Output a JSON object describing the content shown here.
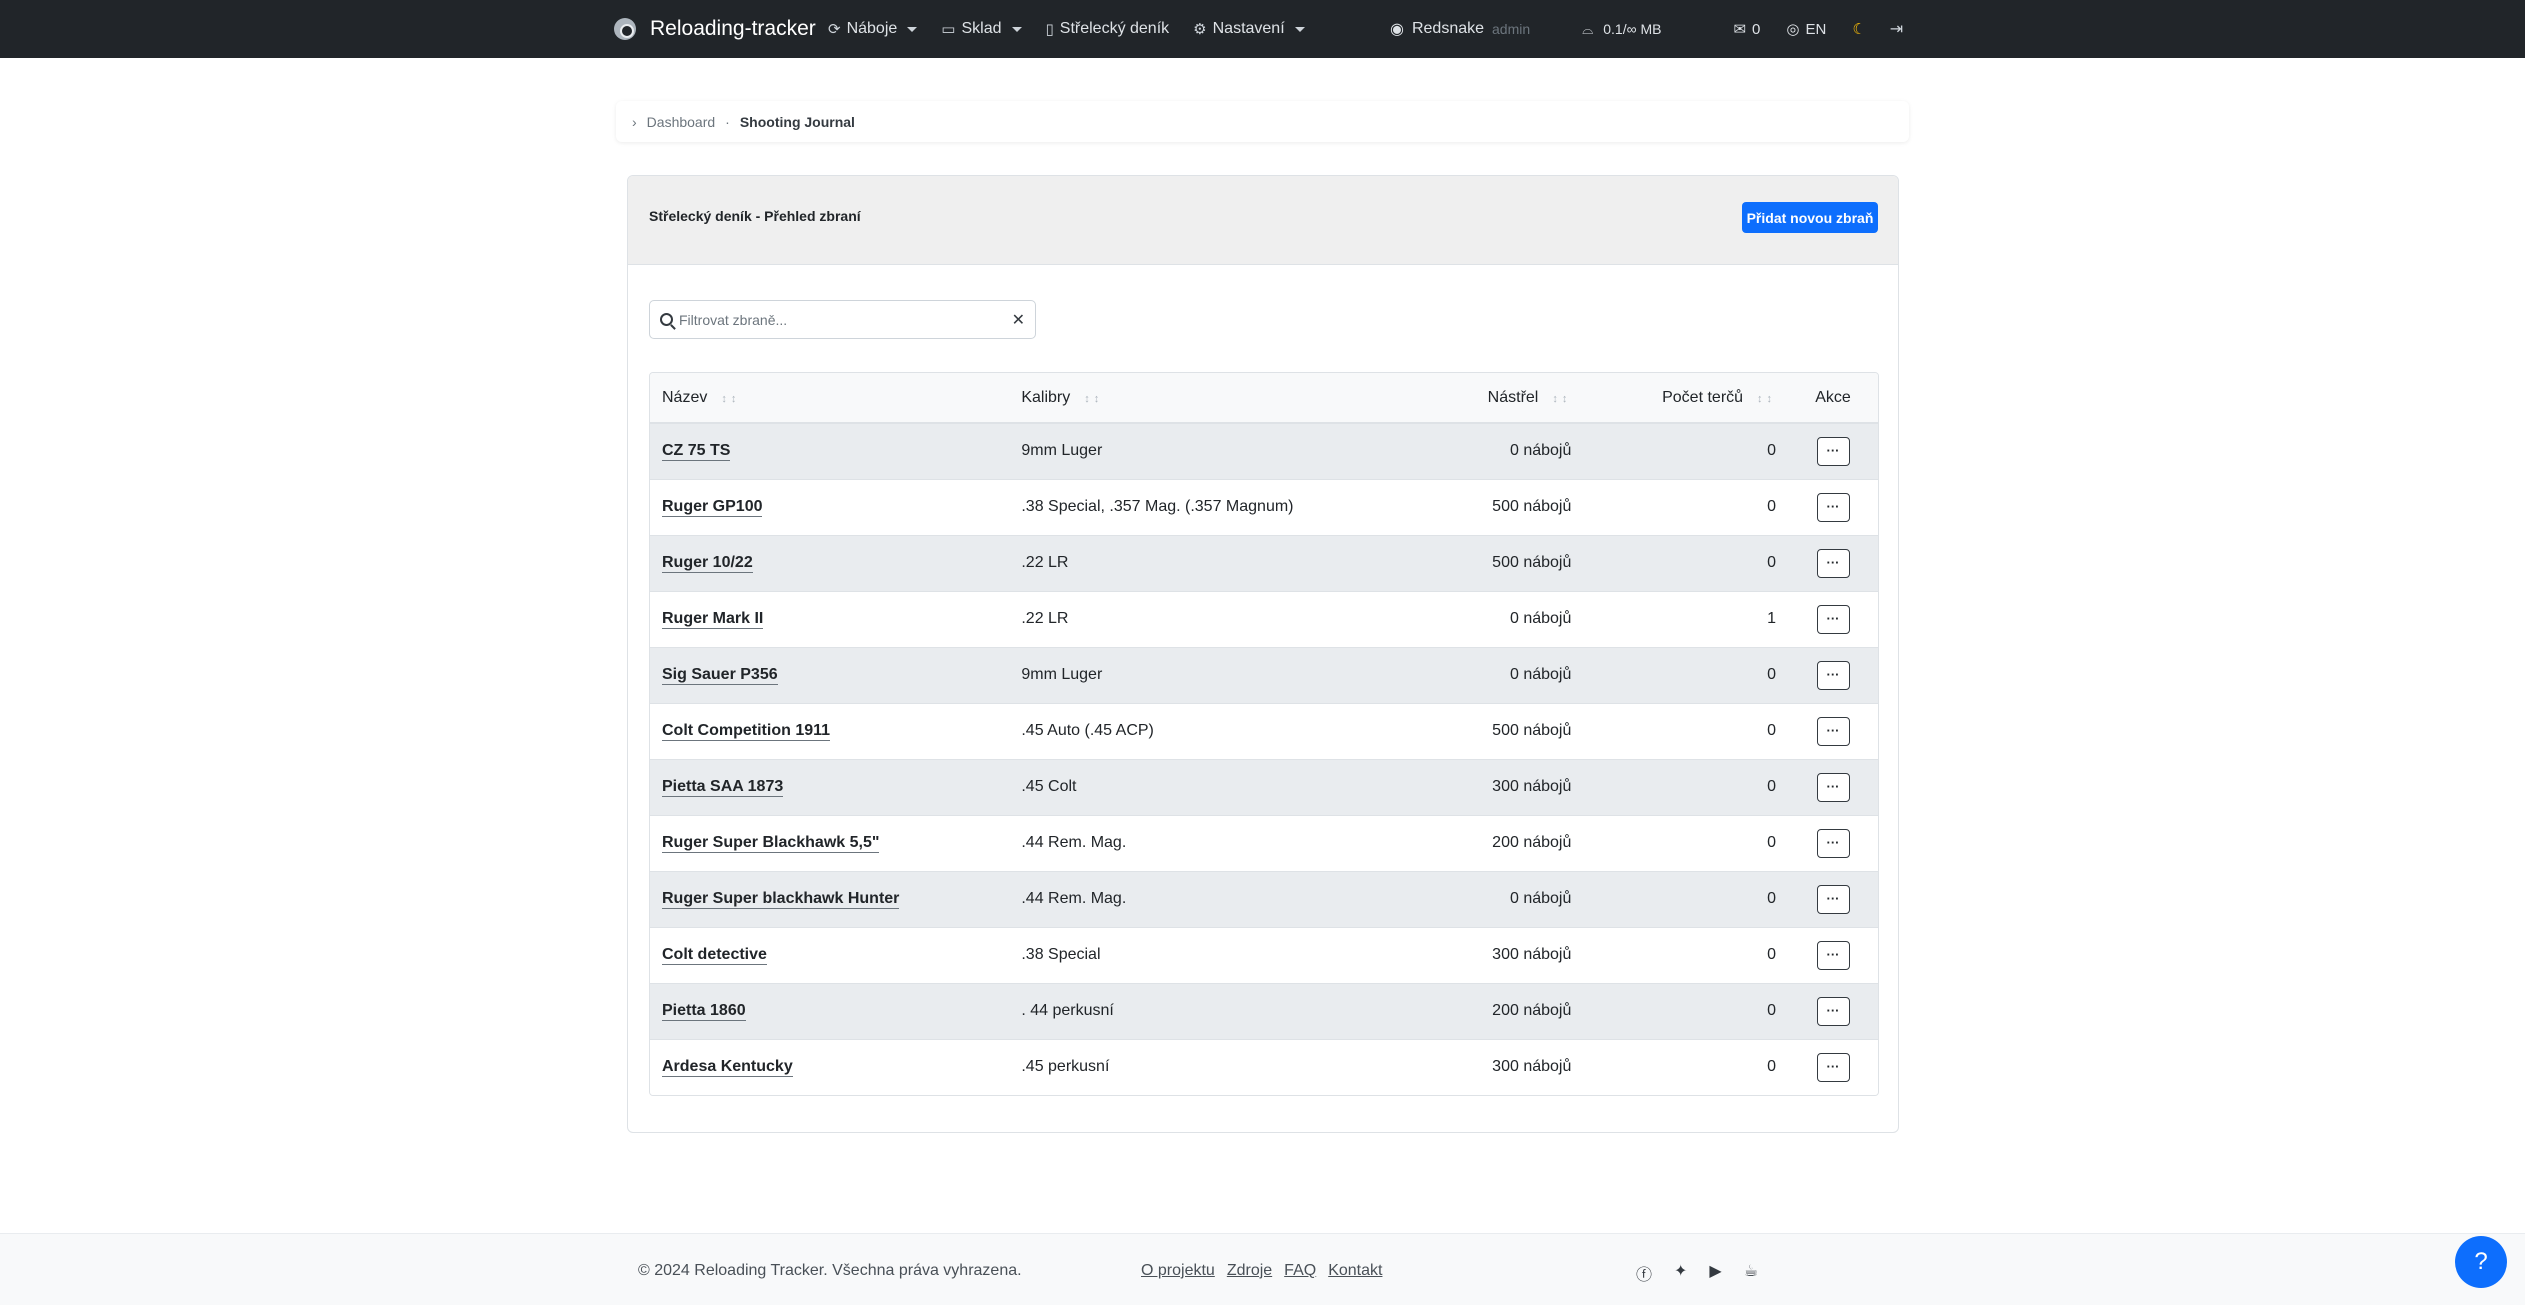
{
  "navbar": {
    "brand": "Reloading-tracker",
    "items": [
      {
        "label": "Náboje",
        "icon": "refresh-icon",
        "dropdown": true
      },
      {
        "label": "Sklad",
        "icon": "box-icon",
        "dropdown": true
      },
      {
        "label": "Střelecký deník",
        "icon": "journal-icon",
        "dropdown": false
      },
      {
        "label": "Nastavení",
        "icon": "gear-icon",
        "dropdown": true
      }
    ],
    "user": "Redsnake",
    "role": "admin",
    "storage": "0.1/∞ MB",
    "messages": "0",
    "lang": "EN"
  },
  "breadcrumb": {
    "home": "Dashboard",
    "current": "Shooting Journal"
  },
  "card": {
    "title": "Střelecký deník - Přehled zbraní",
    "add_button": "Přidat novou zbraň",
    "filter_placeholder": "Filtrovat zbraně..."
  },
  "table": {
    "headers": {
      "name": "Název",
      "calibers": "Kalibry",
      "shots": "Nástřel",
      "targets": "Počet terčů",
      "actions": "Akce"
    },
    "action_label": "···",
    "rows": [
      {
        "name": "CZ 75 TS",
        "calibers": "9mm Luger",
        "shots": "0 nábojů",
        "targets": "0"
      },
      {
        "name": "Ruger GP100",
        "calibers": ".38 Special, .357 Mag. (.357 Magnum)",
        "shots": "500 nábojů",
        "targets": "0"
      },
      {
        "name": "Ruger 10/22",
        "calibers": ".22 LR",
        "shots": "500 nábojů",
        "targets": "0"
      },
      {
        "name": "Ruger Mark II",
        "calibers": ".22 LR",
        "shots": "0 nábojů",
        "targets": "1"
      },
      {
        "name": "Sig Sauer P356",
        "calibers": "9mm Luger",
        "shots": "0 nábojů",
        "targets": "0"
      },
      {
        "name": "Colt Competition 1911",
        "calibers": ".45 Auto (.45 ACP)",
        "shots": "500 nábojů",
        "targets": "0"
      },
      {
        "name": "Pietta SAA 1873",
        "calibers": ".45 Colt",
        "shots": "300 nábojů",
        "targets": "0"
      },
      {
        "name": "Ruger Super Blackhawk 5,5\"",
        "calibers": ".44 Rem. Mag.",
        "shots": "200 nábojů",
        "targets": "0"
      },
      {
        "name": "Ruger Super blackhawk Hunter",
        "calibers": ".44 Rem. Mag.",
        "shots": "0 nábojů",
        "targets": "0"
      },
      {
        "name": "Colt detective",
        "calibers": ".38 Special",
        "shots": "300 nábojů",
        "targets": "0"
      },
      {
        "name": "Pietta 1860",
        "calibers": ". 44 perkusní",
        "shots": "200 nábojů",
        "targets": "0"
      },
      {
        "name": "Ardesa Kentucky",
        "calibers": ".45 perkusní",
        "shots": "300 nábojů",
        "targets": "0"
      }
    ]
  },
  "footer": {
    "copyright": "© 2024 Reloading Tracker. Všechna práva vyhrazena.",
    "links": [
      "O projektu",
      "Zdroje",
      "FAQ",
      "Kontakt"
    ],
    "socials": [
      "facebook-icon",
      "twitter-icon",
      "youtube-icon",
      "coffee-icon"
    ],
    "help": "?"
  },
  "colors": {
    "navbar": "#212529",
    "primary": "#0d6efd",
    "striped_row": "#e9ecef"
  }
}
